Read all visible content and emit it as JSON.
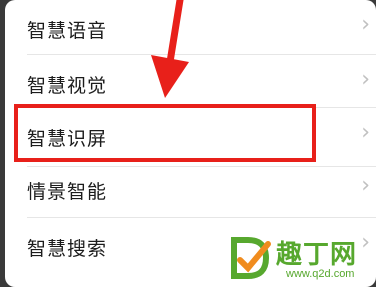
{
  "menu": {
    "items": [
      {
        "label": "智慧语音"
      },
      {
        "label": "智慧视觉"
      },
      {
        "label": "智慧识屏"
      },
      {
        "label": "情景智能"
      },
      {
        "label": "智慧搜索"
      }
    ],
    "chevron": "›"
  },
  "annotation": {
    "color": "#e8201a",
    "highlighted_item": "智慧识屏"
  },
  "watermark": {
    "text": "趣丁网",
    "url": "www.q2d.com",
    "color": "#57a82e"
  }
}
